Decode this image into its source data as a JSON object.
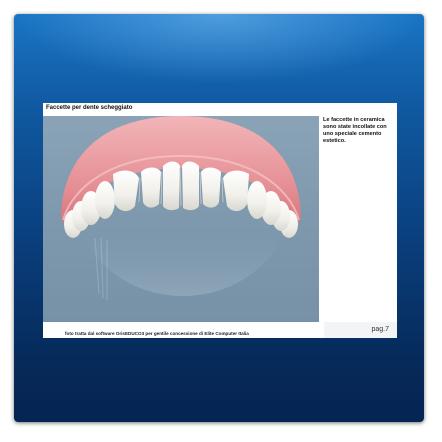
{
  "slide": {
    "title": "Faccette per dente scheggiato",
    "caption": "Le faccette in ceramica sono state incollate con uno speciale cemento estetico.",
    "footer": "foto tratta dal software OrisEDUCO3 per gentile concessione di Elite Computer Italia",
    "page": "pag.7"
  },
  "colors": {
    "frame_top": "#1a75c4",
    "frame_bottom": "#052553",
    "photo_background": "#8aa3b7",
    "gum": "#e69a9e",
    "tooth": "#f4f3ee"
  },
  "icons": {
    "image": "teeth-illustration"
  }
}
